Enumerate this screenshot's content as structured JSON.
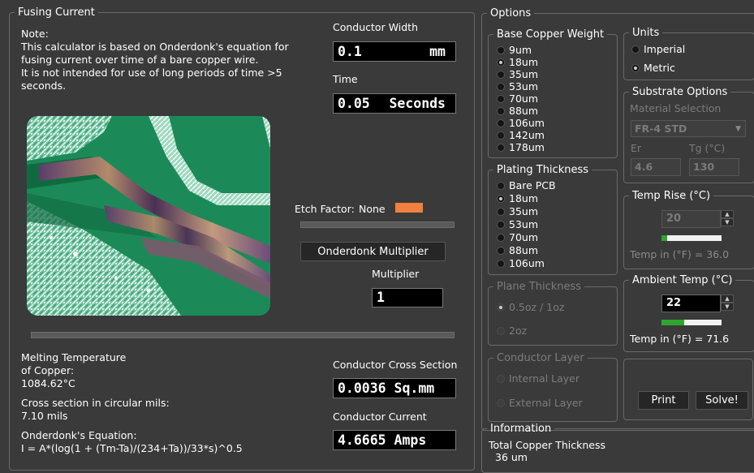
{
  "fusing": {
    "title": "Fusing Current",
    "note_lines": [
      "Note:",
      "This calculator is based on Onderdonk's equation for",
      "fusing current over time of a bare copper wire.",
      "It is not intended for use of long periods of time >5",
      "seconds."
    ],
    "conductor_width_label": "Conductor Width",
    "conductor_width_value": "0.1",
    "conductor_width_unit": "mm",
    "time_label": "Time",
    "time_value": "0.05",
    "time_unit": "Seconds",
    "etch_factor_label": "Etch Factor:",
    "etch_factor_value": "None",
    "etch_factor_color": "#f08040",
    "onderdonk_button": "Onderdonk Multiplier",
    "multiplier_label": "Multiplier",
    "multiplier_value": "1",
    "melting_label_1": "Melting Temperature",
    "melting_label_2": "of Copper:",
    "melting_value": "1084.62°C",
    "cross_mils_label": "Cross section in circular mils:",
    "cross_mils_value": "7.10 mils",
    "equation_label": "Onderdonk's Equation:",
    "equation_value": "I = A*(log(1 + (Tm-Ta)/(234+Ta))/33*s)^0.5",
    "cross_section_label": "Conductor Cross Section",
    "cross_section_value": "0.0036 Sq.mm",
    "current_label": "Conductor Current",
    "current_value": "4.6665 Amps"
  },
  "options": {
    "title": "Options",
    "base_copper": {
      "title": "Base Copper Weight",
      "items": [
        "9um",
        "18um",
        "35um",
        "53um",
        "70um",
        "88um",
        "106um",
        "142um",
        "178um"
      ],
      "selected": "18um"
    },
    "plating": {
      "title": "Plating Thickness",
      "items": [
        "Bare PCB",
        "18um",
        "35um",
        "53um",
        "70um",
        "88um",
        "106um"
      ],
      "selected": "18um"
    },
    "units": {
      "title": "Units",
      "items": [
        "Imperial",
        "Metric"
      ],
      "selected": "Metric"
    },
    "substrate": {
      "title": "Substrate Options",
      "material_label": "Material Selection",
      "material_value": "FR-4 STD",
      "er_label": "Er",
      "er_value": "4.6",
      "tg_label": "Tg (°C)",
      "tg_value": "130"
    },
    "temp_rise": {
      "title": "Temp Rise (°C)",
      "value": "20",
      "fill_fraction": 0.1,
      "temp_f_text": "Temp in (°F) = 36.0"
    },
    "ambient": {
      "title": "Ambient Temp (°C)",
      "value": "22",
      "fill_fraction": 0.38,
      "temp_f_text": "Temp in (°F) = 71.6"
    },
    "plane": {
      "title": "Plane Thickness",
      "items": [
        "0.5oz / 1oz",
        "2oz"
      ],
      "selected": "0.5oz / 1oz"
    },
    "conductor_layer": {
      "title": "Conductor Layer",
      "items": [
        "Internal Layer",
        "External Layer"
      ]
    },
    "print_button": "Print",
    "solve_button": "Solve!"
  },
  "information": {
    "title": "Information",
    "total_copper_label": "Total Copper Thickness",
    "total_copper_value": "36 um"
  }
}
